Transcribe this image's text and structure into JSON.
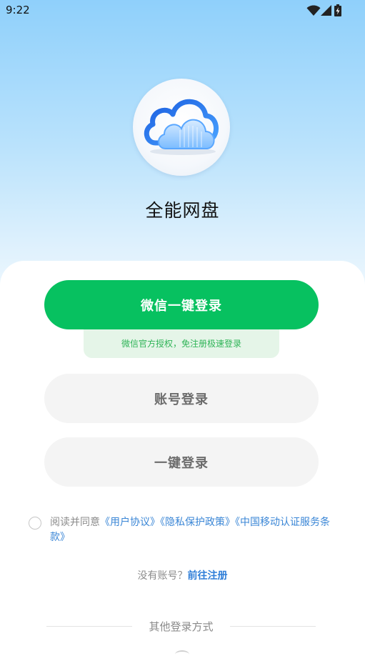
{
  "status_bar": {
    "time": "9:22",
    "icons": [
      "wifi-icon",
      "signal-icon",
      "battery-charging-icon"
    ]
  },
  "app": {
    "name": "全能网盘",
    "logo": "cloud-logo-icon"
  },
  "login": {
    "wechat_button": "微信一键登录",
    "wechat_tip": "微信官方授权，免注册极速登录",
    "account_button": "账号登录",
    "onekey_button": "一键登录"
  },
  "agreement": {
    "prefix": "阅读并同意",
    "user_agreement": "《用户协议》",
    "privacy_policy": "《隐私保护政策》",
    "cmcc_terms": "《中国移动认证服务条款》",
    "checked": false
  },
  "register": {
    "prompt": "没有账号？",
    "link": "前往注册"
  },
  "other_login": {
    "label": "其他登录方式"
  },
  "colors": {
    "wechat_green": "#07c160",
    "link_blue": "#3a86d6",
    "sky_blue": "#8fd0fb"
  }
}
